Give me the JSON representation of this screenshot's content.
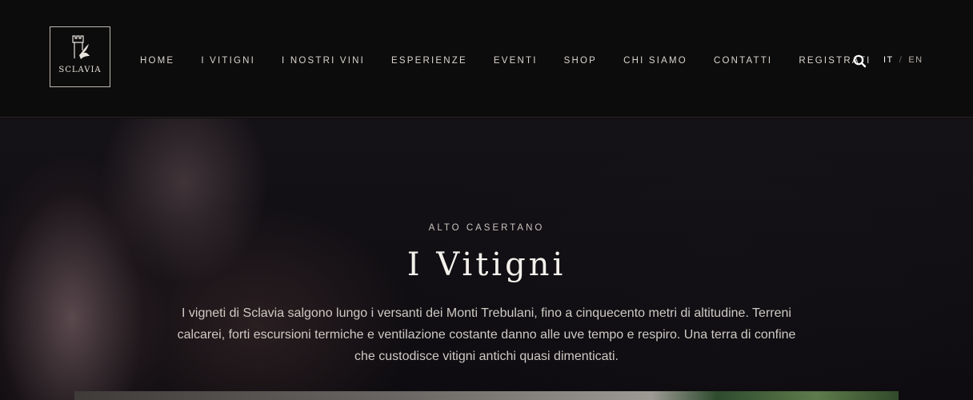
{
  "brand": {
    "logo_text": "SCLAVIA"
  },
  "nav": {
    "items": [
      {
        "label": "HOME"
      },
      {
        "label": "I VITIGNI"
      },
      {
        "label": "I NOSTRI VINI"
      },
      {
        "label": "ESPERIENZE"
      },
      {
        "label": "EVENTI"
      },
      {
        "label": "SHOP"
      },
      {
        "label": "CHI SIAMO"
      },
      {
        "label": "CONTATTI"
      },
      {
        "label": "REGISTRATI"
      }
    ]
  },
  "icons": {
    "search": "search-icon",
    "logo_mark": "tower-bird-icon"
  },
  "language": {
    "it": "IT",
    "separator": "/",
    "en": "EN"
  },
  "hero": {
    "kicker": "ALTO CASERTANO",
    "title": "I Vitigni",
    "description": "I vigneti di Sclavia salgono lungo i versanti dei Monti Trebulani, fino a cinquecento metri di altitudine. Terreni calcarei, forti escursioni termiche e ventilazione costante danno alle uve tempo e respiro. Una terra di confine che custodisce vitigni antichi quasi dimenticati."
  },
  "colors": {
    "background": "#0d0c0c",
    "text": "#e6e2dc",
    "accent_white": "#ffffff"
  }
}
